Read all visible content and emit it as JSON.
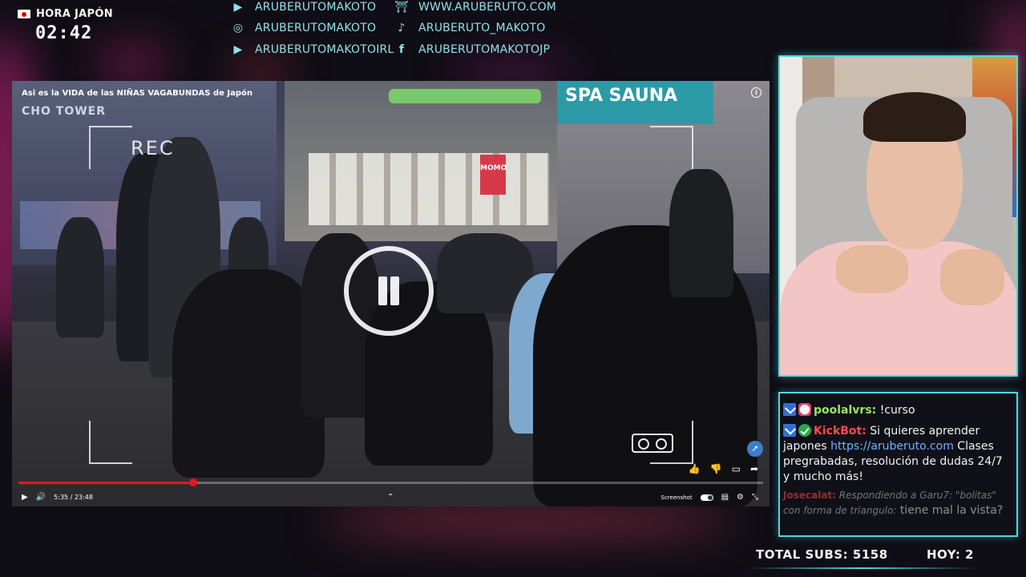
{
  "clock": {
    "label": "HORA JAPÓN",
    "time": "02:42"
  },
  "socials": [
    {
      "icon": "youtube-icon",
      "glyph": "▶",
      "text": "ARUBERUTOMAKOTO"
    },
    {
      "icon": "instagram-icon",
      "glyph": "◎",
      "text": "ARUBERUTOMAKOTO"
    },
    {
      "icon": "youtube-icon",
      "glyph": "▶",
      "text": "ARUBERUTOMAKOTOIRL"
    },
    {
      "icon": "torii-gate-icon",
      "glyph": "⛩",
      "text": "WWW.ARUBERUTO.COM"
    },
    {
      "icon": "tiktok-icon",
      "glyph": "♪",
      "text": "ARUBERUTO_MAKOTO"
    },
    {
      "icon": "facebook-icon",
      "glyph": "f",
      "text": "ARUBERUTOMAKOTOJP"
    }
  ],
  "video": {
    "title": "Asi es la VIDA de las NIÑAS VAGABUNDAS de Japón",
    "rec_label": "REC",
    "time": "5:35 / 23:48",
    "progress": 0.235,
    "screenshot_label": "Screenshot",
    "signs": {
      "sauna": "SPA SAUNA",
      "tower": "CHO TOWER",
      "momo": "MOMO"
    }
  },
  "chat": {
    "m1_user": "poolalvrs:",
    "m1_text": " !curso",
    "m2_user": "KickBot:",
    "m2_text": " Si quieres aprender japones ",
    "m2_link": "https://aruberuto.com",
    "m2_text2": " Clases pregrabadas, resolución de dudas 24/7 y mucho más!",
    "m3_user": "Josecalat:",
    "m3_reply": "Respondiendo a Garu7: \"bolitas\" con forma de triangulo:",
    "m3_text": " tiene mal la vista?"
  },
  "stats": {
    "total_subs": "TOTAL SUBS: 5158",
    "today": "HOY: 2"
  },
  "colors": {
    "accent": "#4fd8e2",
    "kick_red": "#ff4a4a",
    "pool_green": "#9be564",
    "progress_red": "#e0191f"
  }
}
